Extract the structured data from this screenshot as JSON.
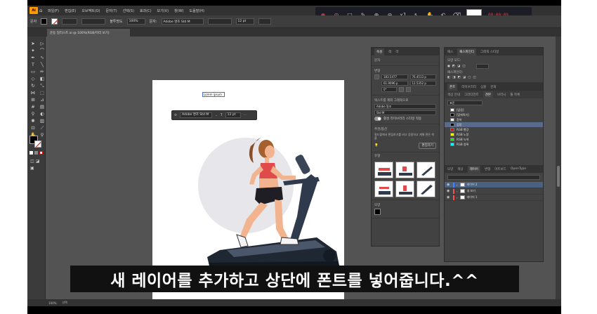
{
  "menubar": {
    "logo": "Ai",
    "items": [
      "파일(F)",
      "편집(E)",
      "오브젝트(O)",
      "문자(T)",
      "선택(S)",
      "효과(C)",
      "보기(V)",
      "창(W)",
      "도움말(H)"
    ]
  },
  "recorder": {
    "timer": "00:00:09"
  },
  "controlbar": {
    "label": "문자",
    "opacity_label": "불투명도",
    "opacity_value": "100%",
    "char_label": "문자:",
    "font_value": "Adobe 명조 Std M",
    "size_value": "12 pt"
  },
  "document": {
    "tab_title": "운동 일러스트.ai @ 100%(RGB/미리 보기)"
  },
  "artboard": {
    "text_frame": "Lorem ipsum"
  },
  "floatbar": {
    "font": "Adobe 명조 Std M",
    "size": "12 pt"
  },
  "props_panel": {
    "tabs": [
      "속성",
      "레",
      "라"
    ],
    "type_label": "문자",
    "transform_label": "변형",
    "x": "183.5477",
    "y": "76.4513 p",
    "w": "61.9096 p",
    "h": "12.5352 p",
    "angle": "0°",
    "font_section": "텍스트를 제외 그래픽으로",
    "font_name": "Adobe 명조",
    "style_name": "Std M",
    "auto_toggle_label": "활성 라이브러리 스타일 적용",
    "rec_title": "추천/옵션",
    "rec_desc": "필드할에서 편집하기를 바고 응용하고 계해 면은 색을",
    "start_button": "편집하기",
    "thumbs_label": "유형",
    "bottom_label": "모양"
  },
  "right_top_panel": {
    "tabs": [
      "패스",
      "패스파인더",
      "그래픽 스타일"
    ],
    "row1": "모양 모드:",
    "row2": "패스파인더:"
  },
  "swatches_panel": {
    "tabs": [
      "폰트",
      "라이브러리",
      "심볼",
      "문화"
    ],
    "sub_tabs": [
      "색상 안내",
      "그라디언트",
      "견본",
      "브러시",
      "툴 목록"
    ],
    "dropdown": "표준",
    "swatches": [
      {
        "name": "[없음]",
        "color": "#ffffff"
      },
      {
        "name": "[맞춰찍기]",
        "color": "#000000"
      },
      {
        "name": "흰색",
        "color": "#ffffff"
      },
      {
        "name": "검정",
        "color": "#000000"
      },
      {
        "name": "RGB 빨강",
        "color": "#ff0000"
      },
      {
        "name": "RGB 노랑",
        "color": "#ffff00"
      },
      {
        "name": "RGB 녹색",
        "color": "#00ff00"
      },
      {
        "name": "RGB 청록",
        "color": "#00ffff"
      }
    ]
  },
  "layers_panel": {
    "tabs": [
      "모양",
      "색상",
      "레이어",
      "변형",
      "아트보드",
      "OpenType"
    ],
    "layers": [
      {
        "name": "레이어 2",
        "color": "#4f7fff"
      },
      {
        "name": "내 보기",
        "color": "#ff4f4f"
      },
      {
        "name": "레이어 1",
        "color": "#ff4f4f"
      }
    ]
  },
  "statusbar": {
    "zoom": "100%",
    "mode": "선택"
  },
  "subtitle": "새 레이어를 추가하고 상단에 폰트를 넣어줍니다.^^"
}
